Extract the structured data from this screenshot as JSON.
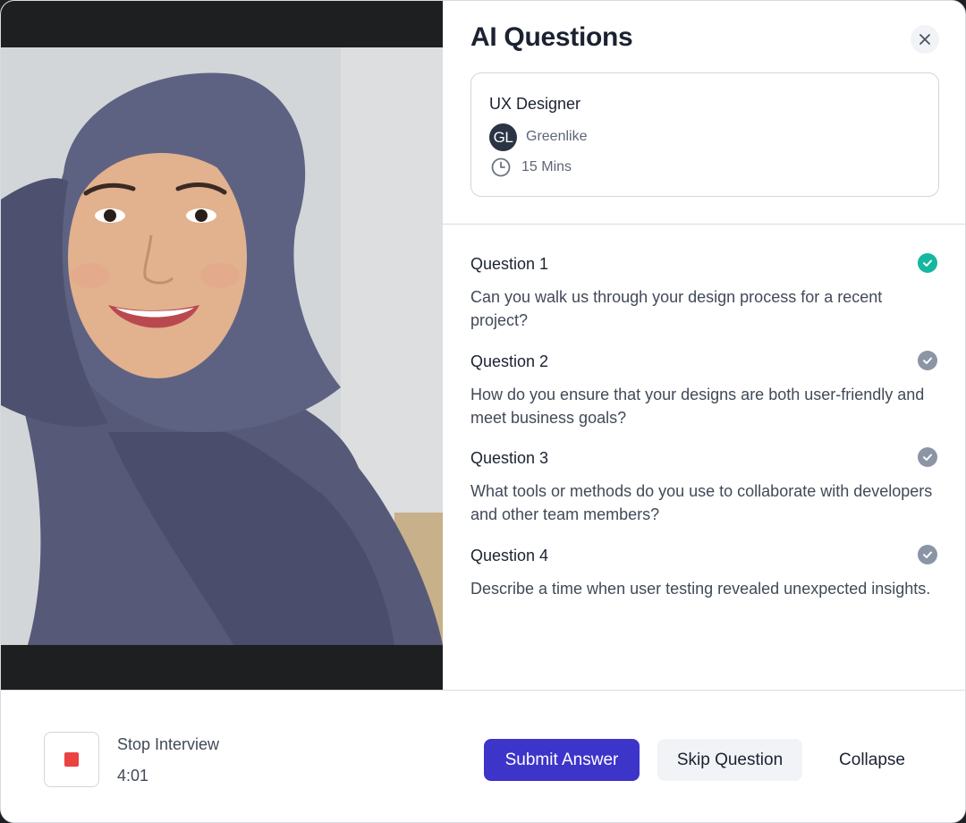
{
  "video": {
    "description_icon": "interviewee-video-feed"
  },
  "panel": {
    "title": "AI Questions",
    "close_icon": "close-icon"
  },
  "job": {
    "title": "UX Designer",
    "company_initials": "GL",
    "company": "Greenlike",
    "duration": "15 Mins"
  },
  "questions": [
    {
      "label": "Question 1",
      "text": "Can you walk us through your design process for a recent project?",
      "status": "done"
    },
    {
      "label": "Question 2",
      "text": "How do you ensure that your designs are both user-friendly and meet business goals?",
      "status": "pending"
    },
    {
      "label": "Question 3",
      "text": "What tools or methods do you use to collaborate with developers and other team members?",
      "status": "pending"
    },
    {
      "label": "Question 4",
      "text": "Describe a time when user testing revealed unexpected insights.",
      "status": "pending"
    }
  ],
  "footer": {
    "stop_label": "Stop Interview",
    "timer": "4:01",
    "submit_label": "Submit Answer",
    "skip_label": "Skip Question",
    "collapse_label": "Collapse"
  },
  "colors": {
    "accent": "#3d34c9",
    "done": "#14b8a0",
    "pending": "#8b95a5",
    "stop": "#ec4141"
  }
}
